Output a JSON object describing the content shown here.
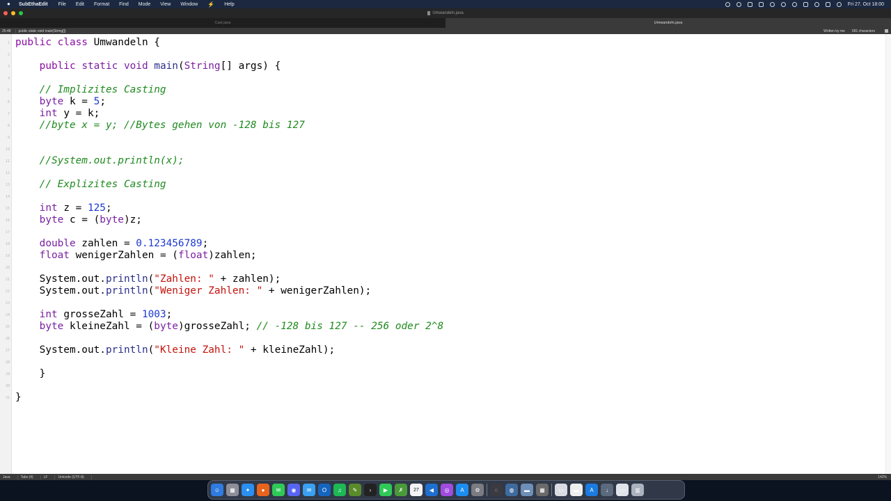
{
  "menubar": {
    "app_name": "SubEthaEdit",
    "items": [
      "File",
      "Edit",
      "Format",
      "Find",
      "Mode",
      "View",
      "Window",
      "Help"
    ],
    "clock": "Fri 27. Oct  18:00"
  },
  "window": {
    "title": "Umwandeln.java"
  },
  "tabs": [
    {
      "label": "Cast.java",
      "active": false
    },
    {
      "label": "Umwandeln.java",
      "active": true
    }
  ],
  "symbolbar": {
    "cursor_position": "25:48",
    "symbol": "public static void main(String[])",
    "written_by": "Written by me",
    "char_count": "581 characters"
  },
  "editor": {
    "line_numbers": [
      "1",
      "2",
      "3",
      "4",
      "5",
      "6",
      "7",
      "8",
      "9",
      "10",
      "11",
      "12",
      "13",
      "14",
      "15",
      "16",
      "17",
      "18",
      "19",
      "20",
      "21",
      "22",
      "23",
      "24",
      "25",
      "26",
      "27",
      "28",
      "29",
      "30",
      "31"
    ],
    "lines": [
      [
        {
          "t": "kw",
          "v": "public class "
        },
        {
          "t": "p",
          "v": "Umwandeln {"
        }
      ],
      [],
      [
        {
          "t": "p",
          "v": "    "
        },
        {
          "t": "kw",
          "v": "public "
        },
        {
          "t": "type",
          "v": "static void "
        },
        {
          "t": "meth",
          "v": "main"
        },
        {
          "t": "p",
          "v": "("
        },
        {
          "t": "type",
          "v": "String"
        },
        {
          "t": "p",
          "v": "[] args) {"
        }
      ],
      [],
      [
        {
          "t": "p",
          "v": "    "
        },
        {
          "t": "cm",
          "v": "// Implizites Casting"
        }
      ],
      [
        {
          "t": "p",
          "v": "    "
        },
        {
          "t": "type",
          "v": "byte"
        },
        {
          "t": "p",
          "v": " k = "
        },
        {
          "t": "num",
          "v": "5"
        },
        {
          "t": "p",
          "v": ";"
        }
      ],
      [
        {
          "t": "p",
          "v": "    "
        },
        {
          "t": "type",
          "v": "int"
        },
        {
          "t": "p",
          "v": " y = k;"
        }
      ],
      [
        {
          "t": "p",
          "v": "    "
        },
        {
          "t": "cm",
          "v": "//byte x = y; //Bytes gehen von -128 bis 127"
        }
      ],
      [],
      [],
      [
        {
          "t": "p",
          "v": "    "
        },
        {
          "t": "cm",
          "v": "//System.out.println(x);"
        }
      ],
      [],
      [
        {
          "t": "p",
          "v": "    "
        },
        {
          "t": "cm",
          "v": "// Explizites Casting"
        }
      ],
      [],
      [
        {
          "t": "p",
          "v": "    "
        },
        {
          "t": "type",
          "v": "int"
        },
        {
          "t": "p",
          "v": " z = "
        },
        {
          "t": "num",
          "v": "125"
        },
        {
          "t": "p",
          "v": ";"
        }
      ],
      [
        {
          "t": "p",
          "v": "    "
        },
        {
          "t": "type",
          "v": "byte"
        },
        {
          "t": "p",
          "v": " c = ("
        },
        {
          "t": "type",
          "v": "byte"
        },
        {
          "t": "p",
          "v": ")z;"
        }
      ],
      [],
      [
        {
          "t": "p",
          "v": "    "
        },
        {
          "t": "type",
          "v": "double"
        },
        {
          "t": "p",
          "v": " zahlen = "
        },
        {
          "t": "num",
          "v": "0.123456789"
        },
        {
          "t": "p",
          "v": ";"
        }
      ],
      [
        {
          "t": "p",
          "v": "    "
        },
        {
          "t": "type",
          "v": "float"
        },
        {
          "t": "p",
          "v": " wenigerZahlen = ("
        },
        {
          "t": "type",
          "v": "float"
        },
        {
          "t": "p",
          "v": ")zahlen;"
        }
      ],
      [],
      [
        {
          "t": "p",
          "v": "    System.out."
        },
        {
          "t": "meth",
          "v": "println"
        },
        {
          "t": "p",
          "v": "("
        },
        {
          "t": "str",
          "v": "\"Zahlen: \""
        },
        {
          "t": "p",
          "v": " + zahlen);"
        }
      ],
      [
        {
          "t": "p",
          "v": "    System.out."
        },
        {
          "t": "meth",
          "v": "println"
        },
        {
          "t": "p",
          "v": "("
        },
        {
          "t": "str",
          "v": "\"Weniger Zahlen: \""
        },
        {
          "t": "p",
          "v": " + wenigerZahlen);"
        }
      ],
      [],
      [
        {
          "t": "p",
          "v": "    "
        },
        {
          "t": "type",
          "v": "int"
        },
        {
          "t": "p",
          "v": " grosseZahl = "
        },
        {
          "t": "num",
          "v": "1003"
        },
        {
          "t": "p",
          "v": ";"
        }
      ],
      [
        {
          "t": "p",
          "v": "    "
        },
        {
          "t": "type",
          "v": "byte"
        },
        {
          "t": "p",
          "v": " kleineZahl = ("
        },
        {
          "t": "type",
          "v": "byte"
        },
        {
          "t": "p",
          "v": ")grosseZahl; "
        },
        {
          "t": "cm",
          "v": "// -128 bis 127 -- 256 oder 2^8"
        }
      ],
      [],
      [
        {
          "t": "p",
          "v": "    System.out."
        },
        {
          "t": "meth",
          "v": "println"
        },
        {
          "t": "p",
          "v": "("
        },
        {
          "t": "str",
          "v": "\"Kleine Zahl: \""
        },
        {
          "t": "p",
          "v": " + kleineZahl);"
        }
      ],
      [],
      [
        {
          "t": "p",
          "v": "    }"
        }
      ],
      [],
      [
        {
          "t": "p",
          "v": "}"
        }
      ]
    ]
  },
  "statusbar": {
    "mode": "Java",
    "tabs": "Tabs (4)",
    "line_ending": "LF",
    "encoding": "Unicode (UTF-8)",
    "zoom": "142%"
  },
  "dock": {
    "icons": [
      {
        "name": "finder-icon",
        "color": "#2f7ce0",
        "glyph": "☺"
      },
      {
        "name": "launchpad-icon",
        "color": "#8e8e99",
        "glyph": "▦"
      },
      {
        "name": "safari-icon",
        "color": "#2a8ff0",
        "glyph": "✦"
      },
      {
        "name": "firefox-icon",
        "color": "#e8641c",
        "glyph": "●"
      },
      {
        "name": "messages-icon",
        "color": "#2fc957",
        "glyph": "✉"
      },
      {
        "name": "discord-icon",
        "color": "#5865f2",
        "glyph": "◉"
      },
      {
        "name": "mail-icon",
        "color": "#3aa0f2",
        "glyph": "✉"
      },
      {
        "name": "outlook-icon",
        "color": "#1565c0",
        "glyph": "O"
      },
      {
        "name": "spotify-icon",
        "color": "#1db954",
        "glyph": "♫"
      },
      {
        "name": "subethaedit-icon",
        "color": "#5a8a2a",
        "glyph": "✎"
      },
      {
        "name": "terminal-icon",
        "color": "#222222",
        "glyph": "›"
      },
      {
        "name": "facetime-icon",
        "color": "#2fc957",
        "glyph": "▶"
      },
      {
        "name": "script-icon",
        "color": "#4a9a3a",
        "glyph": "✗"
      },
      {
        "name": "calendar-icon",
        "color": "#f4f4f4",
        "glyph": "27"
      },
      {
        "name": "vscode-icon",
        "color": "#1e6fd0",
        "glyph": "◀"
      },
      {
        "name": "podcasts-icon",
        "color": "#a04ce0",
        "glyph": "◎"
      },
      {
        "name": "appstore-icon",
        "color": "#1b8cf0",
        "glyph": "A"
      },
      {
        "name": "settings-icon",
        "color": "#7b7b82",
        "glyph": "⚙"
      },
      {
        "name": "separator"
      },
      {
        "name": "activity-icon",
        "color": "#3a3a40",
        "glyph": "◌"
      },
      {
        "name": "network-icon",
        "color": "#3f6b9e",
        "glyph": "◍"
      },
      {
        "name": "folder-icon",
        "color": "#6d8fb8",
        "glyph": "▬"
      },
      {
        "name": "calculator-icon",
        "color": "#6a6a6a",
        "glyph": "▦"
      },
      {
        "name": "separator"
      },
      {
        "name": "screenshot-icon",
        "color": "#d9dde3",
        "glyph": "▭"
      },
      {
        "name": "window-icon",
        "color": "#eeeeee",
        "glyph": "▬"
      },
      {
        "name": "xcode-icon",
        "color": "#1a7be0",
        "glyph": "A"
      },
      {
        "name": "download-icon",
        "color": "#5b6a7d",
        "glyph": "↓"
      },
      {
        "name": "preview-icon",
        "color": "#dfe3ea",
        "glyph": "▭"
      },
      {
        "name": "trash-icon",
        "color": "#a9b2bd",
        "glyph": "▥"
      }
    ]
  }
}
